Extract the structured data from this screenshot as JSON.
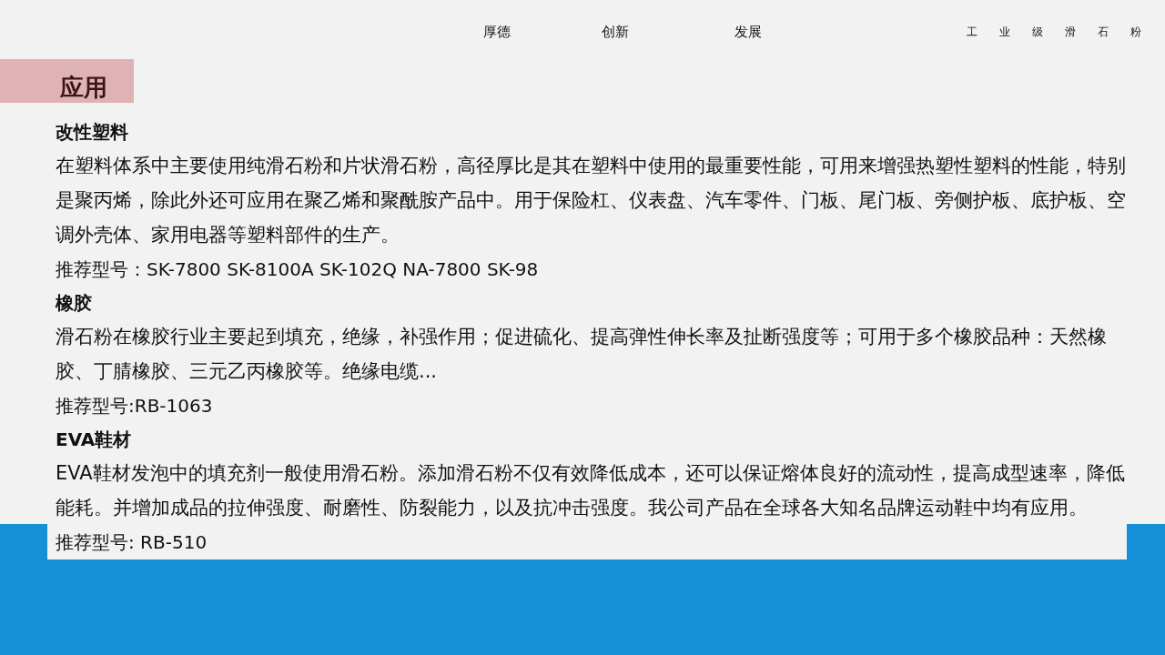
{
  "nav": {
    "links": [
      "厚德",
      "创新",
      "发展"
    ],
    "brand": "工业级滑石粉"
  },
  "section_tag": "应用",
  "sections": [
    {
      "heading": "改性塑料",
      "body": "在塑料体系中主要使用纯滑石粉和片状滑石粉，高径厚比是其在塑料中使用的最重要性能，可用来增强热塑性塑料的性能，特别是聚丙烯，除此外还可应用在聚乙烯和聚酰胺产品中。用于保险杠、仪表盘、汽车零件、门板、尾门板、旁侧护板、底护板、空调外壳体、家用电器等塑料部件的生产。",
      "models": "推荐型号：SK-7800 SK-8100A SK-102Q NA-7800 SK-98"
    },
    {
      "heading": "橡胶",
      "body": "滑石粉在橡胶行业主要起到填充，绝缘，补强作用；促进硫化、提高弹性伸长率及扯断强度等；可用于多个橡胶品种：天然橡胶、丁腈橡胶、三元乙丙橡胶等。绝缘电缆...",
      "models": "推荐型号:RB-1063"
    },
    {
      "heading": "EVA鞋材",
      "body": "EVA鞋材发泡中的填充剂一般使用滑石粉。添加滑石粉不仅有效降低成本，还可以保证熔体良好的流动性，提高成型速率，降低能耗。并增加成品的拉伸强度、耐磨性、防裂能力，以及抗冲击强度。我公司产品在全球各大知名品牌运动鞋中均有应用。",
      "models": "推荐型号: RB-510"
    }
  ]
}
